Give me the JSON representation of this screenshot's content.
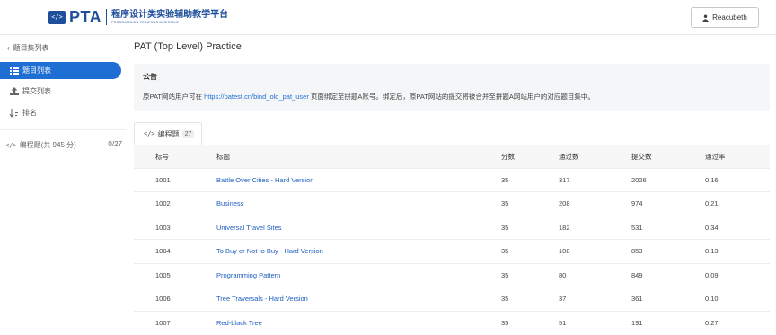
{
  "header": {
    "logo_mark": "</>",
    "logo_text": "PTA",
    "logo_cn": "程序设计类实验辅助教学平台",
    "logo_en": "PROGRAMMING TEACHING ASSISTANT",
    "user_name": "Reacubeth"
  },
  "sidebar": {
    "back_label": "题目集列表",
    "items": [
      {
        "label": "题目列表",
        "icon": "list-icon",
        "active": true
      },
      {
        "label": "提交列表",
        "icon": "upload-icon",
        "active": false
      },
      {
        "label": "排名",
        "icon": "sort-icon",
        "active": false
      }
    ],
    "set": {
      "label": "编程题(共 945 分)",
      "progress": "0/27"
    }
  },
  "main": {
    "title": "PAT (Top Level) Practice",
    "notice_title": "公告",
    "notice_prefix": "原PAT网站用户可在 ",
    "notice_link": "https://patest.cn/bind_old_pat_user",
    "notice_suffix": " 页面绑定至拼题A账号。绑定后，原PAT网站的提交将被合并至拼题A网站用户的对应题目集中。",
    "tab_label": "编程题",
    "tab_count": "27",
    "columns": [
      "标号",
      "标题",
      "分数",
      "通过数",
      "提交数",
      "通过率"
    ],
    "rows": [
      [
        "1001",
        "Battle Over Cities - Hard Version",
        "35",
        "317",
        "2026",
        "0.16"
      ],
      [
        "1002",
        "Business",
        "35",
        "208",
        "974",
        "0.21"
      ],
      [
        "1003",
        "Universal Travel Sites",
        "35",
        "182",
        "531",
        "0.34"
      ],
      [
        "1004",
        "To Buy or Not to Buy - Hard Version",
        "35",
        "108",
        "853",
        "0.13"
      ],
      [
        "1005",
        "Programming Pattern",
        "35",
        "80",
        "849",
        "0.09"
      ],
      [
        "1006",
        "Tree Traversals - Hard Version",
        "35",
        "37",
        "361",
        "0.10"
      ],
      [
        "1007",
        "Red-black Tree",
        "35",
        "51",
        "191",
        "0.27"
      ]
    ]
  }
}
